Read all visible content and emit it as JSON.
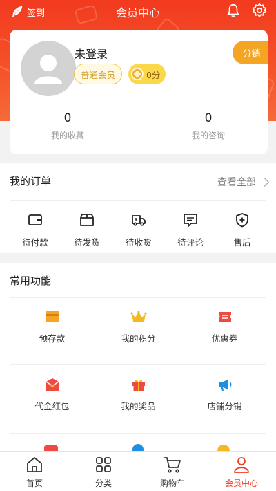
{
  "topbar": {
    "signin_label": "签到",
    "title": "会员中心"
  },
  "profile": {
    "username": "未登录",
    "member_level": "普通会员",
    "points": "0分",
    "distribute_label": "分销"
  },
  "stats": [
    {
      "value": "0",
      "label": "我的收藏"
    },
    {
      "value": "0",
      "label": "我的咨询"
    }
  ],
  "orders": {
    "title": "我的订单",
    "view_all": "查看全部",
    "items": [
      {
        "label": "待付款",
        "icon": "wallet-icon"
      },
      {
        "label": "待发货",
        "icon": "box-icon"
      },
      {
        "label": "待收货",
        "icon": "truck-icon"
      },
      {
        "label": "待评论",
        "icon": "comment-icon"
      },
      {
        "label": "售后",
        "icon": "shield-plus-icon"
      }
    ]
  },
  "functions": {
    "title": "常用功能",
    "items": [
      {
        "label": "预存款",
        "icon": "card-icon"
      },
      {
        "label": "我的积分",
        "icon": "crown-icon"
      },
      {
        "label": "优惠券",
        "icon": "coupon-icon"
      },
      {
        "label": "代金红包",
        "icon": "red-envelope-icon"
      },
      {
        "label": "我的奖品",
        "icon": "gift-icon"
      },
      {
        "label": "店铺分销",
        "icon": "megaphone-icon"
      }
    ]
  },
  "tabbar": {
    "items": [
      {
        "label": "首页",
        "icon": "home-icon"
      },
      {
        "label": "分类",
        "icon": "category-icon"
      },
      {
        "label": "购物车",
        "icon": "cart-icon"
      },
      {
        "label": "会员中心",
        "icon": "user-icon",
        "active": true
      }
    ]
  },
  "colors": {
    "brand": "#f23a1f",
    "accent_orange": "#f5a524",
    "gold": "#fbd84a"
  }
}
